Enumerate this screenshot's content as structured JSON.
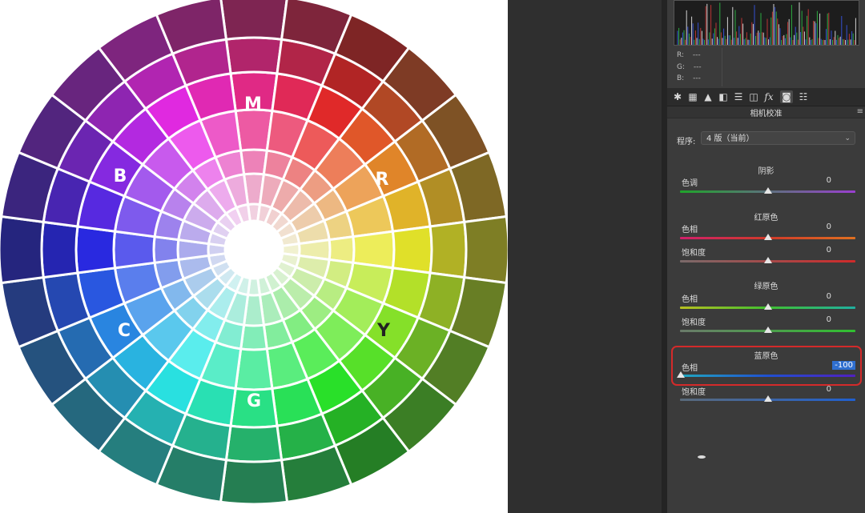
{
  "wheel": {
    "letters": {
      "m": "M",
      "r": "R",
      "y": "Y",
      "g": "G",
      "c": "C",
      "b": "B"
    }
  },
  "info": {
    "r_label": "R:",
    "r_value": "---",
    "g_label": "G:",
    "g_value": "---",
    "b_label": "B:",
    "b_value": "---"
  },
  "tabs": [
    {
      "icon": "aperture-icon"
    },
    {
      "icon": "grid-icon"
    },
    {
      "icon": "mountain-icon"
    },
    {
      "icon": "split-box-icon"
    },
    {
      "icon": "bars-icon"
    },
    {
      "icon": "lens-icon"
    },
    {
      "icon": "fx-icon",
      "label": "fx"
    },
    {
      "icon": "camera-icon"
    },
    {
      "icon": "sliders-icon"
    }
  ],
  "panel": {
    "section_title": "相机校准",
    "program_label": "程序:",
    "program_value": "4 版（当前）",
    "shadow": {
      "title": "阴影",
      "tint_label": "色调",
      "tint_value": "0"
    },
    "red": {
      "title": "红原色",
      "hue_label": "色相",
      "hue_value": "0",
      "sat_label": "饱和度",
      "sat_value": "0"
    },
    "green": {
      "title": "绿原色",
      "hue_label": "色相",
      "hue_value": "0",
      "sat_label": "饱和度",
      "sat_value": "0"
    },
    "blue": {
      "title": "蓝原色",
      "hue_label": "色相",
      "hue_value": "-100",
      "sat_label": "饱和度",
      "sat_value": "0"
    }
  },
  "colors": {
    "highlight_border": "#d42a2a",
    "selected_value_bg": "#2f6fd0"
  }
}
